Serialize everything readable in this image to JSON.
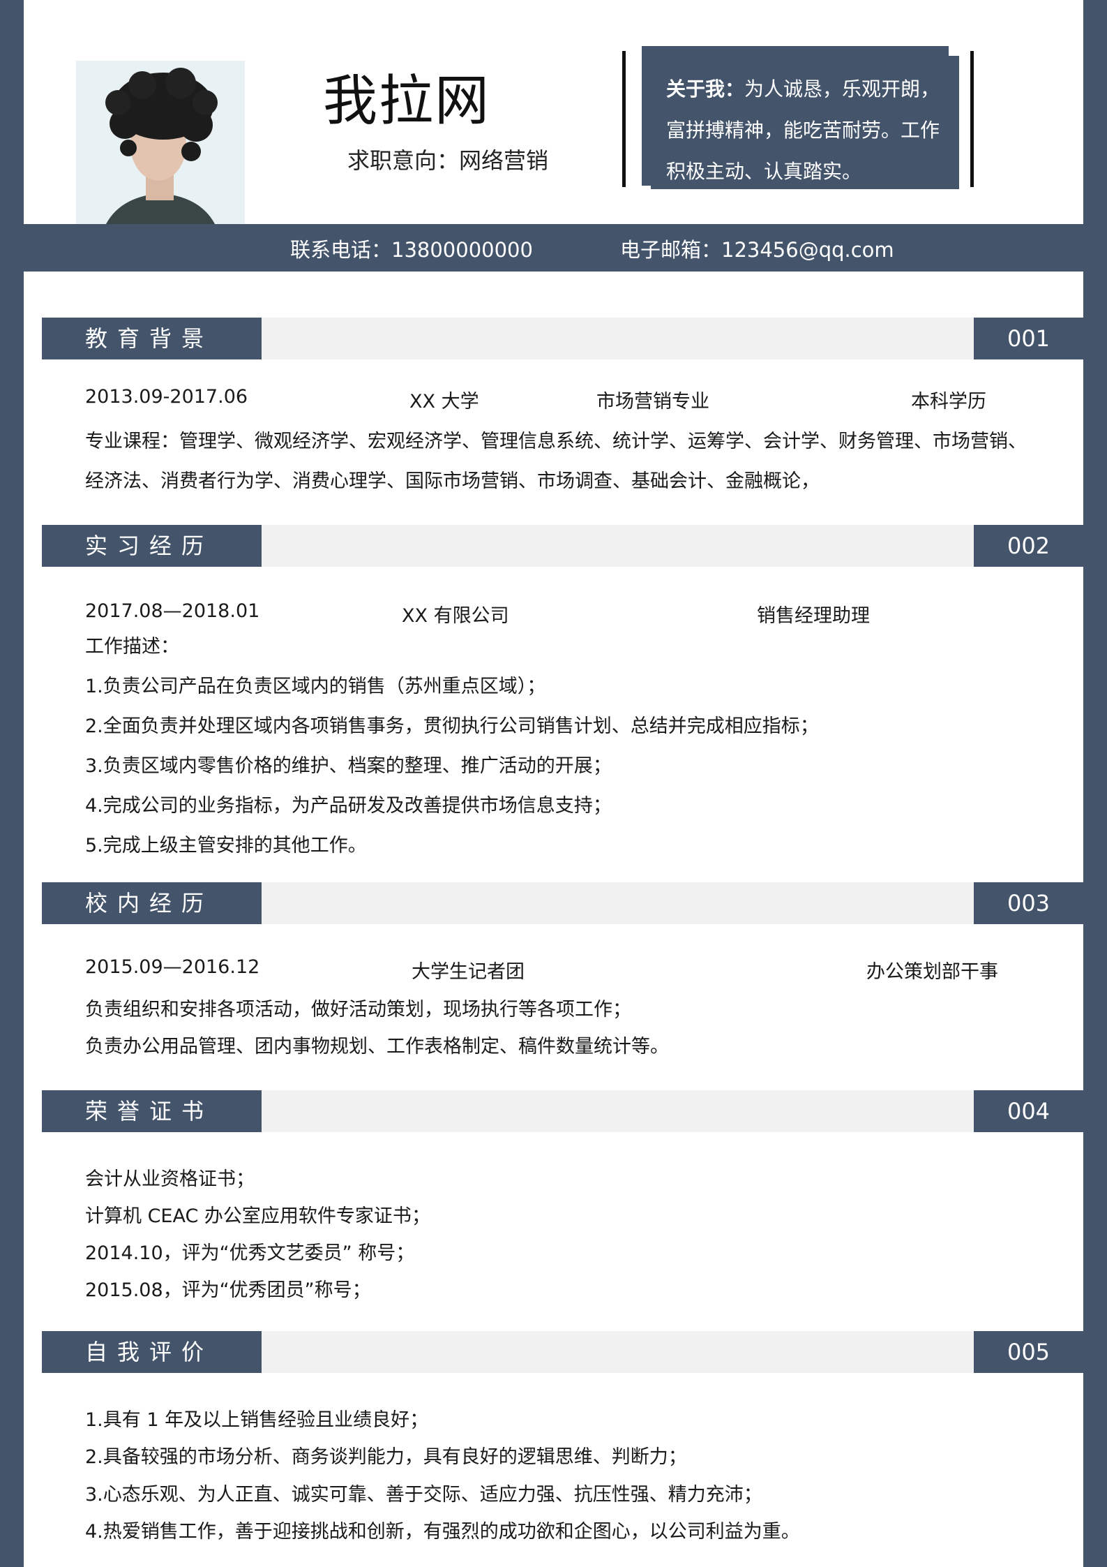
{
  "header": {
    "name": "我拉网",
    "intent": "求职意向：网络营销",
    "about_label": "关于我：",
    "about_lines": [
      "为人诚恳，乐观开朗，",
      "富拼搏精神，能吃苦耐劳。工作",
      "积极主动、认真踏实。"
    ]
  },
  "contact": {
    "phone": "联系电话：13800000000",
    "email": "电子邮箱：123456@qq.com"
  },
  "education": {
    "title": "教育背景",
    "num": "001",
    "period": "2013.09-2017.06",
    "school": "XX 大学",
    "major": "市场营销专业",
    "degree": "本科学历",
    "courses": [
      "专业课程：管理学、微观经济学、宏观经济学、管理信息系统、统计学、运筹学、会计学、财务管理、市场营销、",
      "经济法、消费者行为学、消费心理学、国际市场营销、市场调查、基础会计、金融概论，"
    ]
  },
  "internship": {
    "title": "实习经历",
    "num": "002",
    "period": "2017.08—2018.01",
    "company": "XX 有限公司",
    "role": "销售经理助理",
    "desc_label": "工作描述：",
    "items": [
      "1.负责公司产品在负责区域内的销售（苏州重点区域）；",
      "2.全面负责并处理区域内各项销售事务，贯彻执行公司销售计划、总结并完成相应指标；",
      "3.负责区域内零售价格的维护、档案的整理、推广活动的开展；",
      "4.完成公司的业务指标，为产品研发及改善提供市场信息支持；",
      "5.完成上级主管安排的其他工作。"
    ]
  },
  "campus": {
    "title": "校内经历",
    "num": "003",
    "period": "2015.09—2016.12",
    "org": "大学生记者团",
    "role": "办公策划部干事",
    "items": [
      "负责组织和安排各项活动，做好活动策划，现场执行等各项工作；",
      "负责办公用品管理、团内事物规划、工作表格制定、稿件数量统计等。"
    ]
  },
  "honors": {
    "title": "荣誉证书",
    "num": "004",
    "items": [
      "会计从业资格证书；",
      "计算机 CEAC 办公室应用软件专家证书；",
      "2014.10，评为“优秀文艺委员”  称号；",
      "2015.08，评为“优秀团员”称号；"
    ]
  },
  "self_eval": {
    "title": "自我评价",
    "num": "005",
    "items": [
      "1.具有 1 年及以上销售经验且业绩良好；",
      "2.具备较强的市场分析、商务谈判能力，具有良好的逻辑思维、判断力；",
      "3.心态乐观、为人正直、诚实可靠、善于交际、适应力强、抗压性强、精力充沛；",
      "4.热爱销售工作，善于迎接挑战和创新，有强烈的成功欲和企图心，以公司利益为重。"
    ]
  },
  "colors": {
    "accent": "#44546b",
    "band": "#f1f1f1"
  }
}
